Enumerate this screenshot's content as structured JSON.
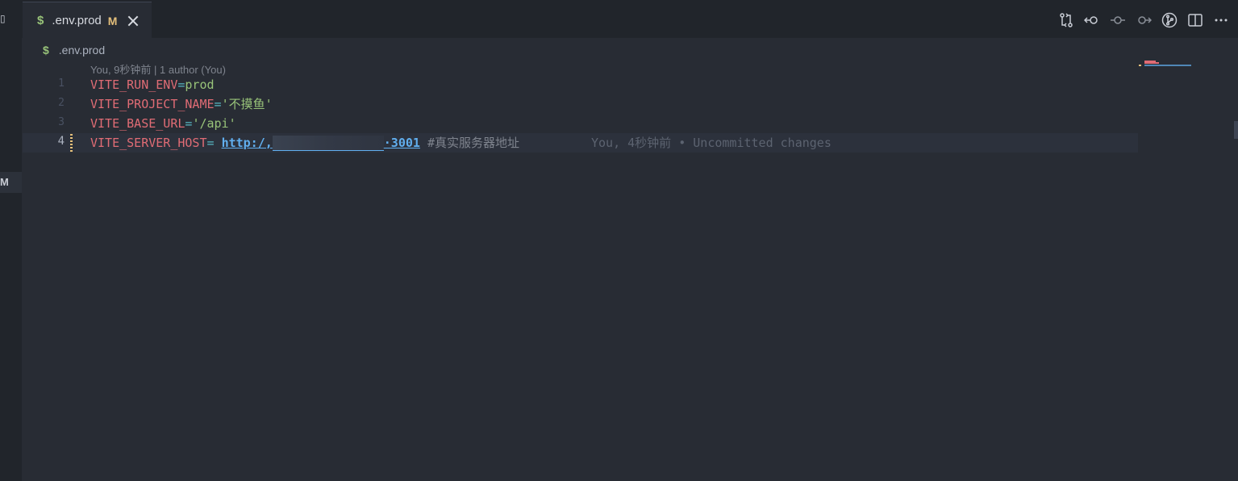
{
  "left_strip": {
    "badge": "M"
  },
  "tab": {
    "icon": "$",
    "name": ".env.prod",
    "status": "M"
  },
  "toolbar": {
    "icons": [
      "open-changes-icon",
      "previous-change-icon",
      "commit-icon",
      "next-change-icon",
      "gitlens-icon",
      "split-editor-icon",
      "more-actions-icon"
    ]
  },
  "breadcrumb": {
    "icon": "$",
    "label": ".env.prod"
  },
  "codelens": "You, 9秒钟前 | 1 author (You)",
  "lines": [
    {
      "number": "1",
      "key": "VITE_RUN_ENV",
      "op": "=",
      "value": "prod"
    },
    {
      "number": "2",
      "key": "VITE_PROJECT_NAME",
      "op": "=",
      "value": "'不摸鱼'"
    },
    {
      "number": "3",
      "key": "VITE_BASE_URL",
      "op": "=",
      "value": "'/api'"
    },
    {
      "number": "4",
      "key": "VITE_SERVER_HOST",
      "op": "= ",
      "url_start": "http:/,",
      "url_end": "·3001",
      "comment": " #真实服务器地址"
    }
  ],
  "blame": "You, 4秒钟前 • Uncommitted changes",
  "colors": {
    "background": "#282c34",
    "key": "#e06c75",
    "string": "#98c379",
    "url": "#61afef",
    "modified": "#e5c07b"
  }
}
